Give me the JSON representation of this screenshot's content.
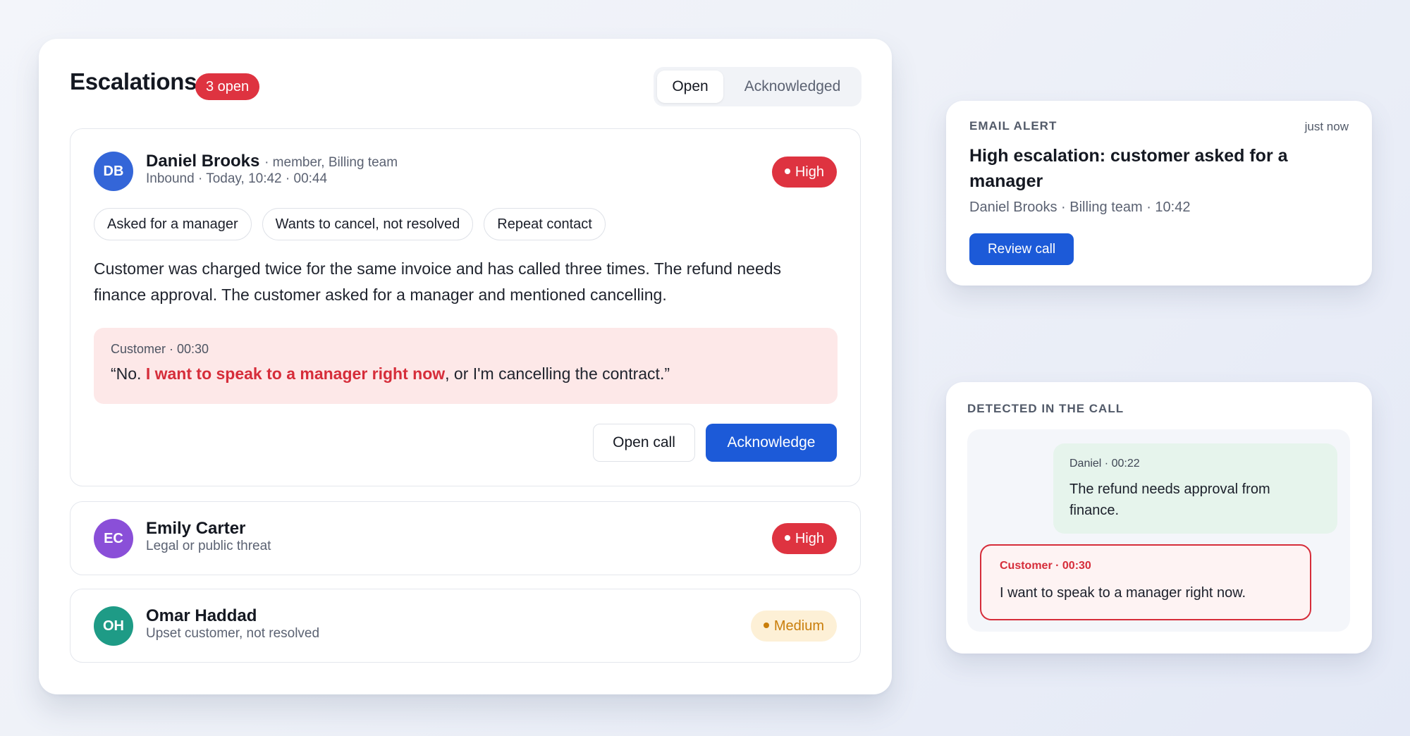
{
  "escalations": {
    "title": "Escalations",
    "open_count_label": "3 open",
    "filter": {
      "open_label": "Open",
      "acknowledged_label": "Acknowledged",
      "selected": "Open"
    },
    "items": [
      {
        "initials": "DB",
        "avatar_color": "#3466d8",
        "name": "Daniel Brooks",
        "role": "· member, Billing team",
        "details": "Inbound · Today, 10:42 · 00:44",
        "priority": "High",
        "priority_color": "#de3340",
        "tags": [
          "Asked for a manager",
          "Wants to cancel, not resolved",
          "Repeat contact"
        ],
        "summary": "Customer was charged twice for the same invoice and has called three times. The refund needs finance approval. The customer asked for a manager and mentioned cancelling.",
        "quote": {
          "meta": "Customer · 00:30",
          "prefix": "“No. ",
          "highlight": "I want to speak to a manager right now",
          "suffix": ", or I'm cancelling the contract.”"
        },
        "open_call_label": "Open call",
        "acknowledge_label": "Acknowledge"
      },
      {
        "initials": "EC",
        "avatar_color": "#8a4fd8",
        "name": "Emily Carter",
        "details": "Legal or public threat",
        "priority": "High",
        "priority_color": "#de3340"
      },
      {
        "initials": "OH",
        "avatar_color": "#1e9b86",
        "name": "Omar Haddad",
        "details": "Upset customer, not resolved",
        "priority": "Medium",
        "priority_color": "#c97e0b"
      }
    ]
  },
  "email_alert": {
    "kicker": "EMAIL ALERT",
    "time": "just now",
    "title": "High escalation: customer asked for a manager",
    "meta": "Daniel Brooks · Billing team · 10:42",
    "button_label": "Review call"
  },
  "detected": {
    "kicker": "DETECTED IN THE CALL",
    "agent_message": {
      "meta": "Daniel · 00:22",
      "text": "The refund needs approval from finance."
    },
    "customer_message": {
      "meta": "Customer · 00:30",
      "text": "I want to speak to a manager right now."
    }
  }
}
